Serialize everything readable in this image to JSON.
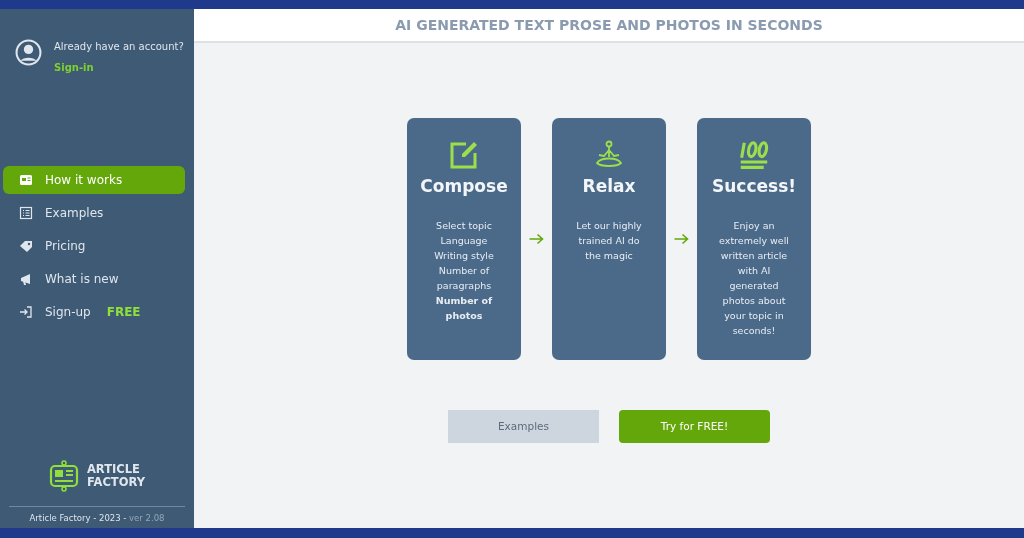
{
  "account": {
    "prompt": "Already have an account?",
    "link": "Sign-in"
  },
  "nav": [
    {
      "label": "How it works",
      "kind": "card",
      "selected": true
    },
    {
      "label": "Examples",
      "kind": "list",
      "selected": false
    },
    {
      "label": "Pricing",
      "kind": "tag",
      "selected": false
    },
    {
      "label": "What is new",
      "kind": "megaphone",
      "selected": false
    },
    {
      "label": "Sign-up",
      "kind": "login",
      "selected": false,
      "badge": "FREE"
    }
  ],
  "logo": {
    "line1": "ARTICLE",
    "line2": "FACTORY"
  },
  "footer": {
    "text": "Article Factory - 2023 -",
    "version": "ver 2.08"
  },
  "header": {
    "title": "AI GENERATED TEXT PROSE AND PHOTOS IN SECONDS"
  },
  "steps": [
    {
      "kind": "compose",
      "title": "Compose",
      "lines": [
        "Select topic",
        "Language",
        "Writing style",
        "Number of paragraphs",
        "**Number of photos**"
      ]
    },
    {
      "kind": "relax",
      "title": "Relax",
      "lines": [
        "Let our highly trained AI do the magic"
      ]
    },
    {
      "kind": "hundred",
      "title": "Success!",
      "lines": [
        "Enjoy an extremely well written article with AI generated photos about your topic in seconds!"
      ]
    }
  ],
  "buttons": [
    {
      "label": "Examples",
      "kind": "secondary"
    },
    {
      "label": "Try for FREE!",
      "kind": "primary"
    }
  ]
}
